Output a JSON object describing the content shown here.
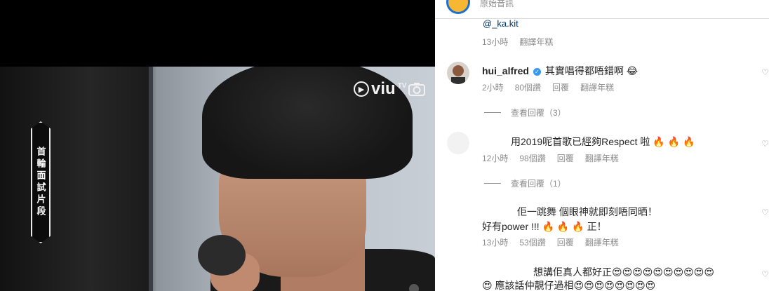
{
  "video": {
    "brand": "viu",
    "brand_sub": "TV",
    "badge_text": "首輪面試片段"
  },
  "header": {
    "subtitle": "原始音訊"
  },
  "thread": {
    "mention": "@_ka.kit",
    "mention_meta": {
      "time": "13小時",
      "translate": "翻譯年糕"
    }
  },
  "comments": [
    {
      "username": "hui_alfred",
      "text": "其實唱得都唔錯啊",
      "emoji": "😂",
      "time": "2小時",
      "likes": "80個讚",
      "reply": "回覆",
      "translate": "翻譯年糕",
      "view_replies": "查看回覆（3）"
    },
    {
      "username": "",
      "text": "用2019呢首歌已經夠Respect 啦",
      "emoji": "🔥 🔥 🔥",
      "time": "12小時",
      "likes": "98個讚",
      "reply": "回覆",
      "translate": "翻譯年糕",
      "view_replies": "查看回覆（1）"
    },
    {
      "username": "",
      "text": "佢一跳舞 個眼神就即刻唔同晒！",
      "text2": "好有power !!!",
      "emoji2": "🔥 🔥 🔥",
      "text2_end": "正！",
      "time": "13小時",
      "likes": "53個讚",
      "reply": "回覆",
      "translate": "翻譯年糕"
    },
    {
      "text": "想講佢真人都好正",
      "emoji": "😍😍😍😍😍😍😍😍😍😍",
      "text2_start": "😍",
      "text2": "應該話仲靚仔過相",
      "emoji2": "😍😍😍😍😍😍😍😍"
    }
  ],
  "icons": {
    "heart": "heart-icon",
    "verified": "verified-badge-icon",
    "camera": "camera-icon"
  },
  "colors": {
    "link": "#00376b",
    "meta": "#8e8e8e",
    "verified": "#3897f0"
  }
}
